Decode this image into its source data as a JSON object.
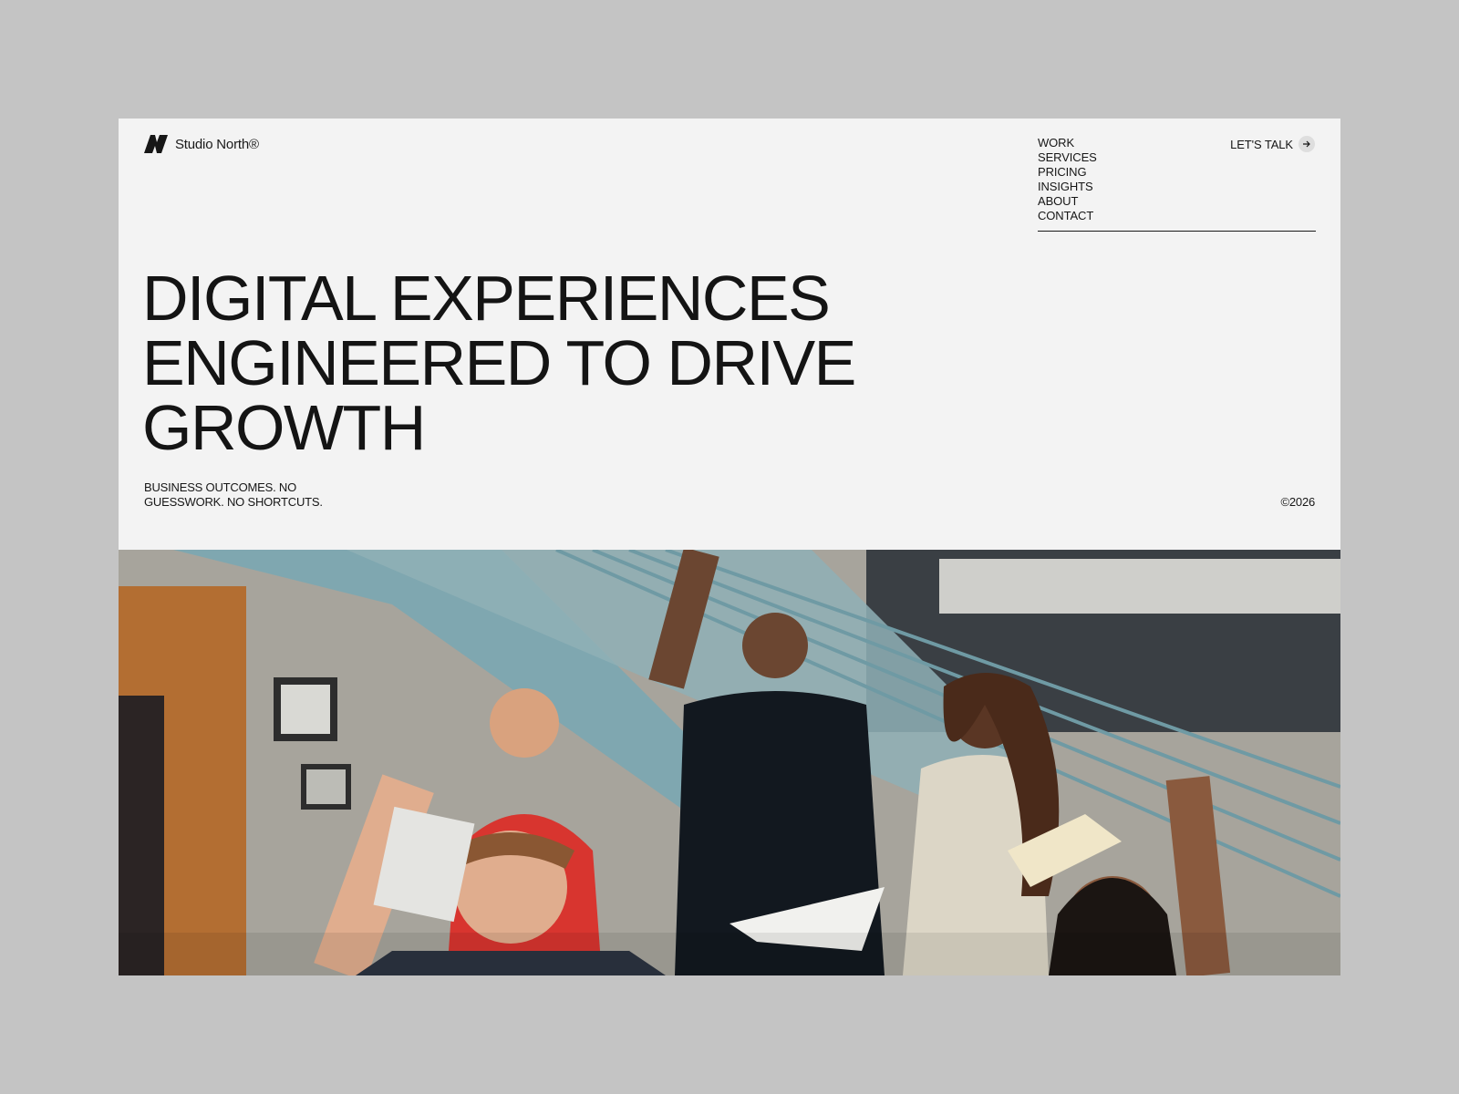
{
  "brand": {
    "name": "Studio North®"
  },
  "nav": {
    "items": [
      {
        "label": "WORK"
      },
      {
        "label": "SERVICES"
      },
      {
        "label": "PRICING"
      },
      {
        "label": "INSIGHTS"
      },
      {
        "label": "ABOUT"
      },
      {
        "label": "CONTACT"
      }
    ],
    "cta_label": "LET'S TALK",
    "cta_icon": "arrow-right-icon"
  },
  "hero": {
    "title_lines": [
      "DIGITAL EXPERIENCES",
      "ENGINEERED TO DRIVE",
      "GROWTH"
    ],
    "tagline": "BUSINESS OUTCOMES. NO GUESSWORK. NO SHORTCUTS.",
    "copyright": "©2026"
  },
  "colors": {
    "page_background": "#f3f3f3",
    "outer_background": "#c4c4c4",
    "text": "#161616"
  }
}
